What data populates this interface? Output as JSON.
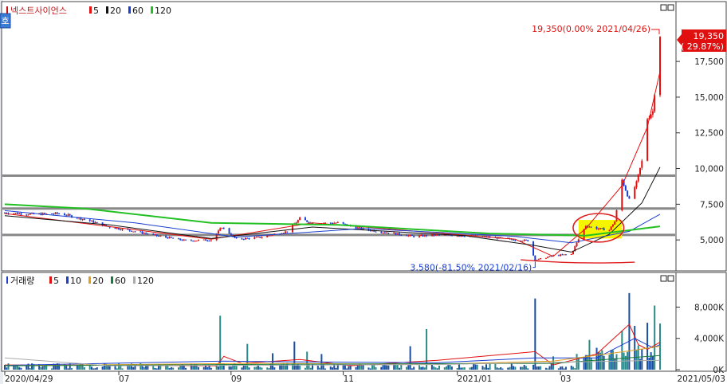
{
  "toolbar": {
    "side_tab_label": "호",
    "price_title": "넥스트사이언스",
    "price_legend": [
      {
        "label": "5",
        "color": "#e01010"
      },
      {
        "label": "20",
        "color": "#111111"
      },
      {
        "label": "60",
        "color": "#1a3fd0"
      },
      {
        "label": "120",
        "color": "#22c022"
      }
    ],
    "volume_title": "거래량",
    "volume_legend": [
      {
        "label": "5",
        "color": "#e01010"
      },
      {
        "label": "10",
        "color": "#1a3fd0"
      },
      {
        "label": "20",
        "color": "#e0a020"
      },
      {
        "label": "60",
        "color": "#1a7a3a"
      },
      {
        "label": "120",
        "color": "#aaaaaa"
      }
    ]
  },
  "chart_data": [
    {
      "type": "candlestick",
      "title": "넥스트사이언스",
      "ylim": [
        3000,
        20800
      ],
      "y_ticks": [
        5000,
        7500,
        10000,
        12500,
        15000,
        17500
      ],
      "y_tick_labels": [
        "5,000",
        "7,500",
        "10,000",
        "12,500",
        "15,000",
        "17,500"
      ],
      "current_price_label": "19,350",
      "current_change_label": "( 29.87%)",
      "annotations": {
        "high": {
          "text": "19,350(0.00% 2021/04/26)",
          "date": "2021-04-26",
          "value": 19350
        },
        "low": {
          "text": "3,580(-81.50% 2021/02/16)",
          "date": "2021-02-16",
          "value": 3580
        }
      },
      "horizontal_lines": [
        9500,
        7200,
        5350
      ],
      "price_path": [
        [
          "2020-04-29",
          6900
        ],
        [
          "2020-05-15",
          6800
        ],
        [
          "2020-05-29",
          6850
        ],
        [
          "2020-06-12",
          6450
        ],
        [
          "2020-06-26",
          5900
        ],
        [
          "2020-07-10",
          5600
        ],
        [
          "2020-07-24",
          5250
        ],
        [
          "2020-08-07",
          4950
        ],
        [
          "2020-08-21",
          5000
        ],
        [
          "2020-08-27",
          5900
        ],
        [
          "2020-09-04",
          5050
        ],
        [
          "2020-09-18",
          5200
        ],
        [
          "2020-10-02",
          5600
        ],
        [
          "2020-10-09",
          6500
        ],
        [
          "2020-10-16",
          6150
        ],
        [
          "2020-10-30",
          6200
        ],
        [
          "2020-11-13",
          5750
        ],
        [
          "2020-11-27",
          5500
        ],
        [
          "2020-12-11",
          5250
        ],
        [
          "2020-12-24",
          5350
        ],
        [
          "2021-01-08",
          5300
        ],
        [
          "2021-01-22",
          5200
        ],
        [
          "2021-02-05",
          5000
        ],
        [
          "2021-02-12",
          4950
        ],
        [
          "2021-02-16",
          3580
        ],
        [
          "2021-02-26",
          3900
        ],
        [
          "2021-03-08",
          4000
        ],
        [
          "2021-03-11",
          4800
        ],
        [
          "2021-03-16",
          6000
        ],
        [
          "2021-03-22",
          5800
        ],
        [
          "2021-03-29",
          5700
        ],
        [
          "2021-04-01",
          6300
        ],
        [
          "2021-04-05",
          9200
        ],
        [
          "2021-04-09",
          7800
        ],
        [
          "2021-04-13",
          9000
        ],
        [
          "2021-04-16",
          10500
        ],
        [
          "2021-04-19",
          13500
        ],
        [
          "2021-04-22",
          14000
        ],
        [
          "2021-04-26",
          19350
        ]
      ],
      "ma_series": [
        {
          "name": "5",
          "color": "#e01010",
          "points": [
            [
              "2020-04-29",
              6850
            ],
            [
              "2020-08-21",
              5050
            ],
            [
              "2020-10-16",
              6200
            ],
            [
              "2021-02-05",
              5050
            ],
            [
              "2021-02-26",
              3850
            ],
            [
              "2021-03-16",
              5800
            ],
            [
              "2021-04-05",
              8800
            ],
            [
              "2021-04-19",
              12900
            ],
            [
              "2021-04-26",
              16800
            ]
          ]
        },
        {
          "name": "20",
          "color": "#111111",
          "points": [
            [
              "2020-04-29",
              6700
            ],
            [
              "2020-06-26",
              6050
            ],
            [
              "2020-08-21",
              5100
            ],
            [
              "2020-10-16",
              5900
            ],
            [
              "2021-01-08",
              5300
            ],
            [
              "2021-02-16",
              4600
            ],
            [
              "2021-03-08",
              4150
            ],
            [
              "2021-03-29",
              5400
            ],
            [
              "2021-04-16",
              7600
            ],
            [
              "2021-04-26",
              10100
            ]
          ]
        },
        {
          "name": "60",
          "color": "#1a3fd0",
          "points": [
            [
              "2020-04-29",
              7050
            ],
            [
              "2020-07-10",
              6200
            ],
            [
              "2020-09-04",
              5200
            ],
            [
              "2020-11-13",
              5800
            ],
            [
              "2021-02-05",
              5250
            ],
            [
              "2021-03-08",
              4800
            ],
            [
              "2021-04-09",
              5600
            ],
            [
              "2021-04-26",
              6800
            ]
          ]
        },
        {
          "name": "120",
          "color": "#22c022",
          "points": [
            [
              "2020-04-29",
              7500
            ],
            [
              "2020-06-12",
              7200
            ],
            [
              "2020-08-21",
              6200
            ],
            [
              "2020-10-30",
              6050
            ],
            [
              "2021-01-22",
              5450
            ],
            [
              "2021-03-16",
              5300
            ],
            [
              "2021-04-26",
              5950
            ]
          ]
        }
      ],
      "highlight_box": {
        "from": "2021-03-12",
        "to": "2021-04-05",
        "low": 5100,
        "high": 6400,
        "color": "#f5f500"
      },
      "markup_ellipse": {
        "from": "2021-03-09",
        "to": "2021-04-06",
        "low": 4850,
        "high": 6850,
        "color": "#e02020"
      },
      "markup_underline": {
        "from": "2021-02-08",
        "to": "2021-04-12",
        "value": 3500,
        "color": "#e02020"
      }
    },
    {
      "type": "bar",
      "title": "거래량",
      "ylim": [
        0,
        10800
      ],
      "y_ticks": [
        0,
        4000,
        8000
      ],
      "y_tick_labels": [
        "0K",
        "4,000K",
        "8,000K"
      ],
      "spikes": [
        [
          "2020-08-26",
          6900
        ],
        [
          "2020-09-10",
          3300
        ],
        [
          "2020-09-24",
          2100
        ],
        [
          "2020-10-06",
          3600
        ],
        [
          "2020-10-13",
          2300
        ],
        [
          "2020-10-21",
          2000
        ],
        [
          "2020-12-09",
          3000
        ],
        [
          "2020-12-18",
          5200
        ],
        [
          "2021-02-16",
          9100
        ],
        [
          "2021-02-26",
          1700
        ],
        [
          "2021-03-12",
          1600
        ],
        [
          "2021-03-18",
          3800
        ],
        [
          "2021-03-22",
          2800
        ],
        [
          "2021-04-05",
          5000
        ],
        [
          "2021-04-09",
          9800
        ],
        [
          "2021-04-12",
          5600
        ],
        [
          "2021-04-14",
          3100
        ],
        [
          "2021-04-19",
          6000
        ],
        [
          "2021-04-23",
          8200
        ],
        [
          "2021-04-26",
          5900
        ]
      ],
      "ma_series": [
        {
          "name": "5",
          "color": "#e01010",
          "points": [
            [
              "2020-04-29",
              600
            ],
            [
              "2020-08-24",
              500
            ],
            [
              "2020-08-28",
              1700
            ],
            [
              "2020-09-07",
              800
            ],
            [
              "2020-10-09",
              1300
            ],
            [
              "2020-11-06",
              500
            ],
            [
              "2020-12-24",
              1200
            ],
            [
              "2021-02-16",
              2300
            ],
            [
              "2021-02-26",
              600
            ],
            [
              "2021-03-22",
              2000
            ],
            [
              "2021-04-09",
              5800
            ],
            [
              "2021-04-14",
              3200
            ],
            [
              "2021-04-19",
              2600
            ],
            [
              "2021-04-26",
              3500
            ]
          ]
        },
        {
          "name": "10",
          "color": "#1a3fd0",
          "points": [
            [
              "2020-04-29",
              550
            ],
            [
              "2020-08-28",
              1100
            ],
            [
              "2020-10-09",
              1000
            ],
            [
              "2020-12-24",
              900
            ],
            [
              "2021-02-16",
              1500
            ],
            [
              "2021-03-22",
              1500
            ],
            [
              "2021-04-12",
              4000
            ],
            [
              "2021-04-22",
              2800
            ],
            [
              "2021-04-26",
              3200
            ]
          ]
        },
        {
          "name": "20",
          "color": "#e0a020",
          "points": [
            [
              "2020-04-29",
              500
            ],
            [
              "2020-09-07",
              800
            ],
            [
              "2020-12-24",
              700
            ],
            [
              "2021-02-26",
              1100
            ],
            [
              "2021-04-12",
              2500
            ],
            [
              "2021-04-26",
              3000
            ]
          ]
        },
        {
          "name": "60",
          "color": "#1a7a3a",
          "points": [
            [
              "2020-04-29",
              500
            ],
            [
              "2020-10-09",
              700
            ],
            [
              "2021-02-26",
              800
            ],
            [
              "2021-04-26",
              1800
            ]
          ]
        },
        {
          "name": "120",
          "color": "#aaaaaa",
          "points": [
            [
              "2020-04-29",
              1500
            ],
            [
              "2020-06-26",
              500
            ],
            [
              "2020-12-24",
              650
            ],
            [
              "2021-04-26",
              1200
            ]
          ]
        }
      ]
    }
  ],
  "x_axis": {
    "ticks": [
      {
        "label": "2020/04/29",
        "date": "2020-04-29"
      },
      {
        "label": "07",
        "date": "2020-07-01"
      },
      {
        "label": "09",
        "date": "2020-09-01"
      },
      {
        "label": "11",
        "date": "2020-11-02"
      },
      {
        "label": "2021/01",
        "date": "2021-01-04"
      },
      {
        "label": "03",
        "date": "2021-03-02"
      }
    ],
    "end_label": "2021/05/03"
  }
}
